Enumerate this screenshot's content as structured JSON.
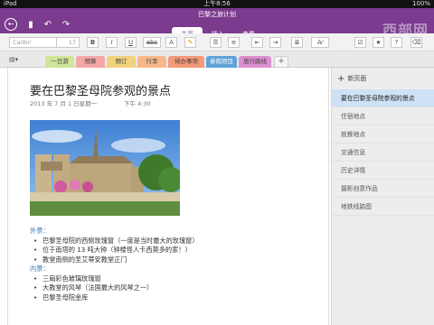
{
  "status": {
    "carrier": "iPad",
    "time": "上午8:56",
    "battery": "100%"
  },
  "title": "巴黎之旅计划",
  "watermark": "西部网",
  "ribbon_tabs": [
    {
      "label": "主页",
      "active": true
    },
    {
      "label": "插入",
      "active": false
    },
    {
      "label": "查看",
      "active": false
    }
  ],
  "toolbar": {
    "font": "Calibri",
    "size": "17"
  },
  "section_tabs": [
    {
      "label": "一日游",
      "color": "#cfe59a",
      "active": false
    },
    {
      "label": "预算",
      "color": "#f5a6a6",
      "active": false
    },
    {
      "label": "预订",
      "color": "#f2d27e",
      "active": false
    },
    {
      "label": "行李",
      "color": "#f7b98b",
      "active": false
    },
    {
      "label": "待办事项",
      "color": "#f39a7a",
      "active": false
    },
    {
      "label": "参观项目",
      "color": "#5fa3d8",
      "active": true
    },
    {
      "label": "旅行路线",
      "color": "#dd8fcf",
      "active": false
    }
  ],
  "page": {
    "title": "要在巴黎圣母院参观的景点",
    "date": "2013 年 7 月 1 日星期一",
    "time": "下午 4:30",
    "outside_label": "外景：",
    "outside_items": [
      "巴黎圣母院的西侧玫瑰窗（一度是当时最大的玫瑰窗）",
      "位于南塔的 13 吨大钟（钟楼怪人卡西莫多的家！）",
      "教堂南侧的圣艾蒂安教堂正门"
    ],
    "inside_label": "内景：",
    "inside_items": [
      "三扇彩色玻璃玫瑰窗",
      "大教堂的风琴（法国最大的风琴之一）",
      "巴黎圣母院金库"
    ]
  },
  "sidebar": {
    "new_page": "新页面",
    "pages": [
      {
        "label": "要在巴黎圣母院参观的景点",
        "active": true
      },
      {
        "label": "住宿地点",
        "active": false
      },
      {
        "label": "就餐地点",
        "active": false
      },
      {
        "label": "交通信息",
        "active": false
      },
      {
        "label": "历史详情",
        "active": false
      },
      {
        "label": "摄影创意作品",
        "active": false
      },
      {
        "label": "地铁线路图",
        "active": false
      }
    ]
  }
}
